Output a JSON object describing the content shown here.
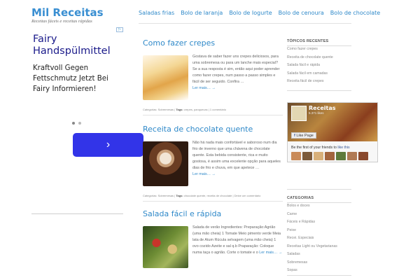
{
  "site": {
    "title": "Mil Receitas",
    "tagline": "Receitas fáceis e receitas rápidas"
  },
  "nav": [
    "Saladas frias",
    "Bolo de laranja",
    "Bolo de Iogurte",
    "Bolo de cenoura",
    "Bolo de chocolate"
  ],
  "ad": {
    "choices_icon": "ad-choices-icon",
    "headline": "Fairy Handspülmittel",
    "body": "Kraftvoll Gegen Fettschmutz Jetzt Bei Fairy Informieren!",
    "button_icon": "chevron-right-icon",
    "button_glyph": "›",
    "slides": 2,
    "active_slide": 1
  },
  "posts": [
    {
      "title": "Como fazer crepes",
      "excerpt": "Gostava de saber fazer uns crepes deliciosos, para uma sobremesa ou para um lanche mais especial? Se a sua resposta é sim, então aqui poder aprender como fazer crepes, num passo a passo simples e fácil de ser seguido. Confira …",
      "more": "Ler mais… →",
      "meta": {
        "categories_label": "Categorias:",
        "categories": "Sobremesas",
        "tags_label": "Tags:",
        "tags": "crepes, panquecas",
        "comments": "1 comentário"
      },
      "thumb_colors": [
        "#f1d08a",
        "#e6a94a"
      ]
    },
    {
      "title": "Receita de chocolate quente",
      "excerpt": "Não há nada mais confortável e saboroso num dia frio de inverno que uma chávena de chocolate quente. Esta bebida consistente, rica e muito gostosa, é assim uma excelente opção para aqueles dias de frio e chuva, em que apetece …",
      "more": "Ler mais… →",
      "meta": {
        "categories_label": "Categorias:",
        "categories": "Sobremesas",
        "tags_label": "Tags:",
        "tags": "chocolate quente, receita de chocolate",
        "comments": "Deixe um comentário"
      },
      "thumb_colors": [
        "#3b2419",
        "#c9a78a"
      ]
    },
    {
      "title": "Salada fácil e rápida",
      "excerpt": "Salada de verão Ingredientes: Preparação:Agrião (uma mão cheia) 1 Tomate Meio pimento verde Meia lata de Atum Rúcula selvagem (uma mão cheia) 1 ovo cozido Azeite e sal q.b Praparação: Coloque numa taça o agrião. Corte o tomate e o",
      "more": "Ler mais… →",
      "thumb_colors": [
        "#4d6b2a",
        "#c23b2a"
      ]
    }
  ],
  "sidebar": {
    "recent_title": "TÓPICOS RECENTES",
    "recent": [
      "Como fazer crepes",
      "Receita de chocolate quente",
      "Salada fácil e rápida",
      "Salada fácil em camadas",
      "Receita fácil de crepes"
    ],
    "facebook": {
      "page_name": "Receitas",
      "likes": "5.371 likes",
      "like_button": "Like Page",
      "friends_text": "Be the first of your friends to",
      "friends_link": "like this"
    },
    "categories_title": "CATEGORIAS",
    "categories": [
      "Bolos e doces",
      "Carne",
      "Fáceis e Rápidas",
      "Peixe",
      "Recei. Especiais",
      "Receitas Light ou Vegetarianas",
      "Saladas",
      "Sobremesas",
      "Sopas"
    ]
  }
}
